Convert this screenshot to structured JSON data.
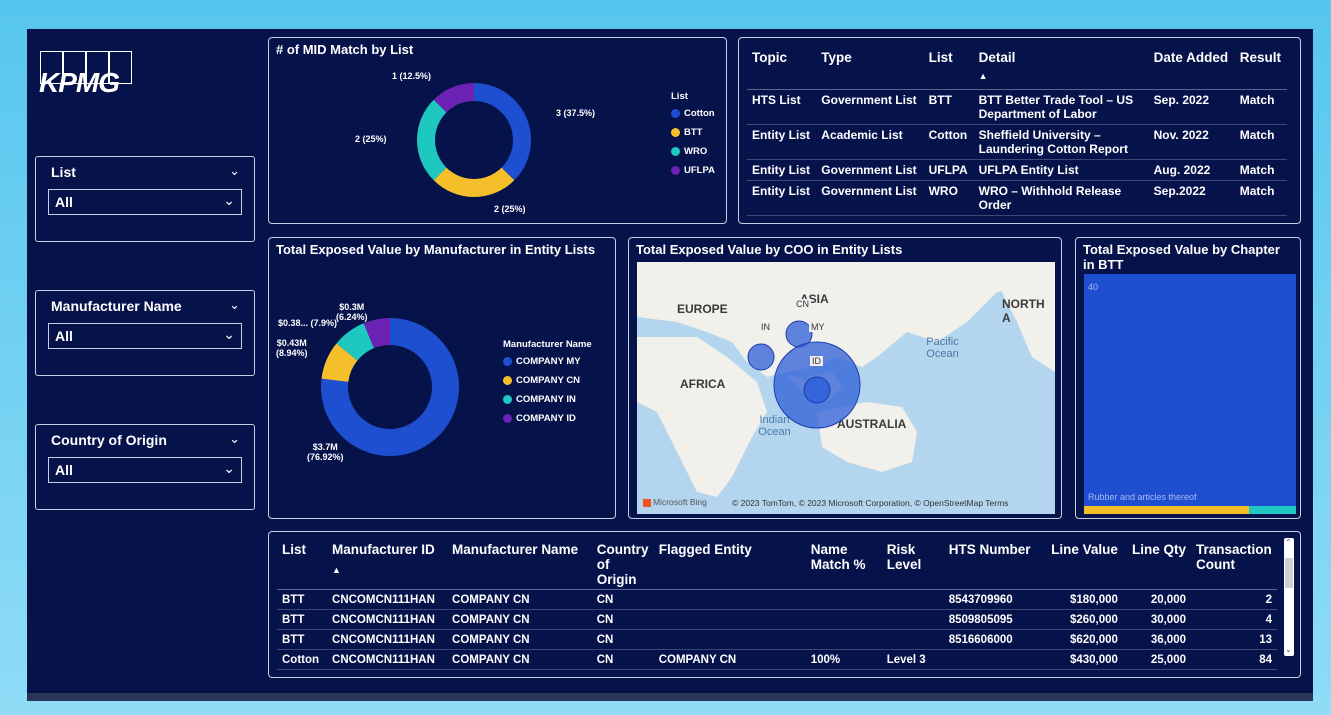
{
  "brand": {
    "logo_text": "KPMG"
  },
  "colors": {
    "blue": "#1f4fd1",
    "yellow": "#f4bf2a",
    "teal": "#1ec8c1",
    "purple": "#6b22b5"
  },
  "slicers": [
    {
      "label": "List",
      "value": "All"
    },
    {
      "label": "Manufacturer Name",
      "value": "All"
    },
    {
      "label": "Country of Origin",
      "value": "All"
    }
  ],
  "mid_chart": {
    "title": "# of MID Match by List",
    "legend_title": "List",
    "labels": [
      "3 (37.5%)",
      "2 (25%)",
      "2 (25%)",
      "1 (12.5%)"
    ]
  },
  "topic_table": {
    "headers": [
      "Topic",
      "Type",
      "List",
      "Detail",
      "Date Added",
      "Result"
    ],
    "rows": [
      [
        "HTS List",
        "Government List",
        "BTT",
        "BTT Better Trade Tool – US Department of Labor",
        "Sep. 2022",
        "Match"
      ],
      [
        "Entity List",
        "Academic List",
        "Cotton",
        "Sheffield University – Laundering Cotton Report",
        "Nov. 2022",
        "Match"
      ],
      [
        "Entity List",
        "Government List",
        "UFLPA",
        "UFLPA Entity List",
        "Aug. 2022",
        "Match"
      ],
      [
        "Entity List",
        "Government List",
        "WRO",
        "WRO – Withhold Release Order",
        "Sep.2022",
        "Match"
      ]
    ]
  },
  "manufacturer_chart": {
    "title": "Total Exposed Value by Manufacturer in Entity Lists",
    "legend_title": "Manufacturer Name",
    "labels": [
      "$3.7M",
      "(76.92%)",
      "$0.43M",
      "(8.94%)",
      "$0.38... (7.9%)",
      "$0.3M",
      "(6.24%)"
    ]
  },
  "coo_map": {
    "title": "Total Exposed Value by COO in Entity Lists",
    "continents": [
      "EUROPE",
      "ASIA",
      "NORTH A",
      "AFRICA",
      "AUSTRALIA"
    ],
    "oceans": [
      "Pacific Ocean",
      "Indian Ocean"
    ],
    "country_labels": [
      "CN",
      "IN",
      "MY",
      "ID"
    ],
    "bing": "Microsoft Bing",
    "attribution": "© 2023 TomTom, © 2023 Microsoft Corporation, © OpenStreetMap  Terms"
  },
  "chapter_chart": {
    "title": "Total Exposed Value by Chapter in BTT",
    "top_label": "40",
    "bottom_label": "Rubber and articles thereof"
  },
  "bottom_table": {
    "headers": [
      "List",
      "Manufacturer ID",
      "Manufacturer Name",
      "Country of Origin",
      "Flagged Entity",
      "Name Match %",
      "Risk Level",
      "HTS Number",
      "Line Value",
      "Line Qty",
      "Transaction Count"
    ],
    "rows": [
      [
        "BTT",
        "CNCOMCN111HAN",
        "COMPANY CN",
        "CN",
        "",
        "",
        "",
        "8543709960",
        "$180,000",
        "20,000",
        "2"
      ],
      [
        "BTT",
        "CNCOMCN111HAN",
        "COMPANY CN",
        "CN",
        "",
        "",
        "",
        "8509805095",
        "$260,000",
        "30,000",
        "4"
      ],
      [
        "BTT",
        "CNCOMCN111HAN",
        "COMPANY CN",
        "CN",
        "",
        "",
        "",
        "8516606000",
        "$620,000",
        "36,000",
        "13"
      ],
      [
        "Cotton",
        "CNCOMCN111HAN",
        "COMPANY CN",
        "CN",
        "COMPANY CN",
        "100%",
        "Level 3",
        "",
        "$430,000",
        "25,000",
        "84"
      ]
    ]
  },
  "chart_data": [
    {
      "type": "pie",
      "title": "# of MID Match by List",
      "legend_title": "List",
      "categories": [
        "Cotton",
        "BTT",
        "WRO",
        "UFLPA"
      ],
      "values": [
        3,
        2,
        2,
        1
      ],
      "percent": [
        37.5,
        25,
        25,
        12.5
      ],
      "colors": [
        "#1f4fd1",
        "#f4bf2a",
        "#1ec8c1",
        "#6b22b5"
      ],
      "donut": true,
      "legend": "right"
    },
    {
      "type": "pie",
      "title": "Total Exposed Value by Manufacturer in Entity Lists",
      "legend_title": "Manufacturer Name",
      "categories": [
        "COMPANY MY",
        "COMPANY CN",
        "COMPANY IN",
        "COMPANY ID"
      ],
      "values": [
        3.7,
        0.43,
        0.38,
        0.3
      ],
      "percent": [
        76.92,
        8.94,
        7.9,
        6.24
      ],
      "colors": [
        "#1f4fd1",
        "#f4bf2a",
        "#1ec8c1",
        "#6b22b5"
      ],
      "donut": true,
      "legend": "right"
    },
    {
      "type": "bar",
      "title": "Total Exposed Value by Chapter in BTT",
      "categories": [
        "40"
      ],
      "stacked_share": [
        0.78,
        0.22
      ],
      "colors": [
        "#1f4fd1",
        "#1ec8c1"
      ],
      "bottom_strip_colors": [
        "#f4bf2a",
        "#1ec8c1"
      ]
    }
  ]
}
